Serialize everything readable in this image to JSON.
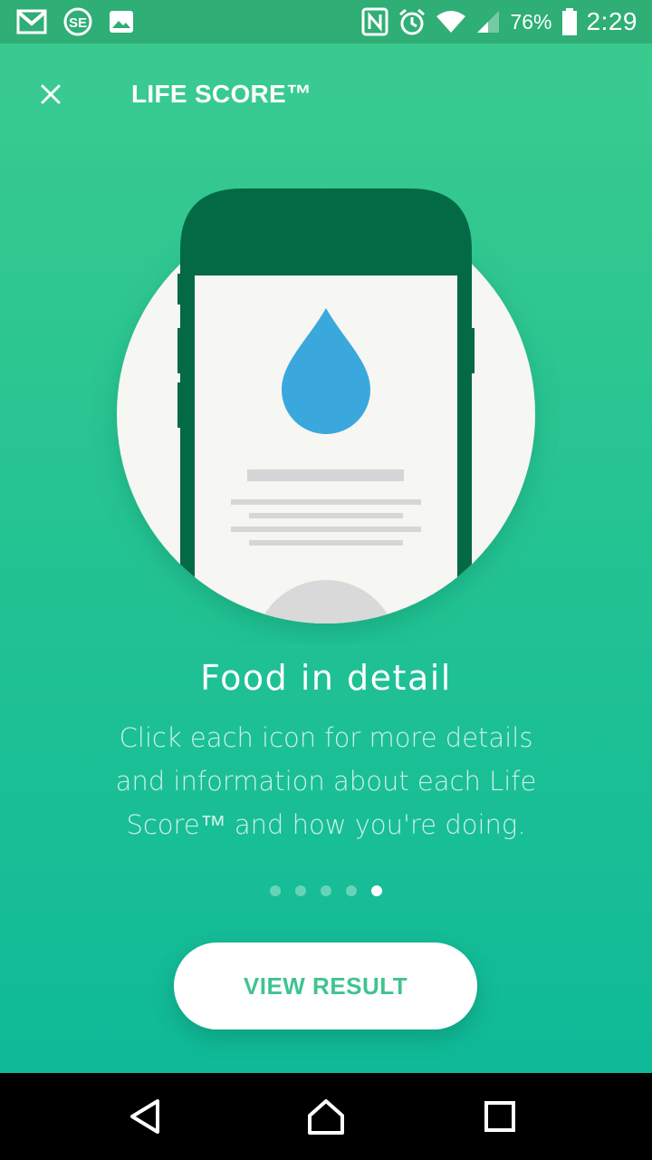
{
  "status_bar": {
    "battery_percent": "76%",
    "time": "2:29",
    "icons": [
      "gmail-icon",
      "se-app-icon",
      "image-icon",
      "nfc-icon",
      "alarm-icon",
      "wifi-icon",
      "signal-icon",
      "battery-icon"
    ]
  },
  "app_bar": {
    "title": "LIFE SCORE™",
    "close_icon": "close-icon"
  },
  "onboarding": {
    "illustration_icon": "water-drop-icon",
    "headline": "Food in detail",
    "description": "Click each icon for more details and information about each Life Score™ and how you're doing.",
    "pages_total": 5,
    "current_page": 5
  },
  "cta": {
    "label": "VIEW RESULT"
  },
  "nav_bar": {
    "icons": [
      "back-icon",
      "home-icon",
      "recents-icon"
    ]
  },
  "colors": {
    "gradient_top": "#3ccb8f",
    "gradient_bottom": "#0fba98",
    "status_bar": "#2fae76",
    "phone_dark": "#046a46",
    "drop_blue": "#3aa8dc",
    "cta_text": "#3fc48f"
  }
}
